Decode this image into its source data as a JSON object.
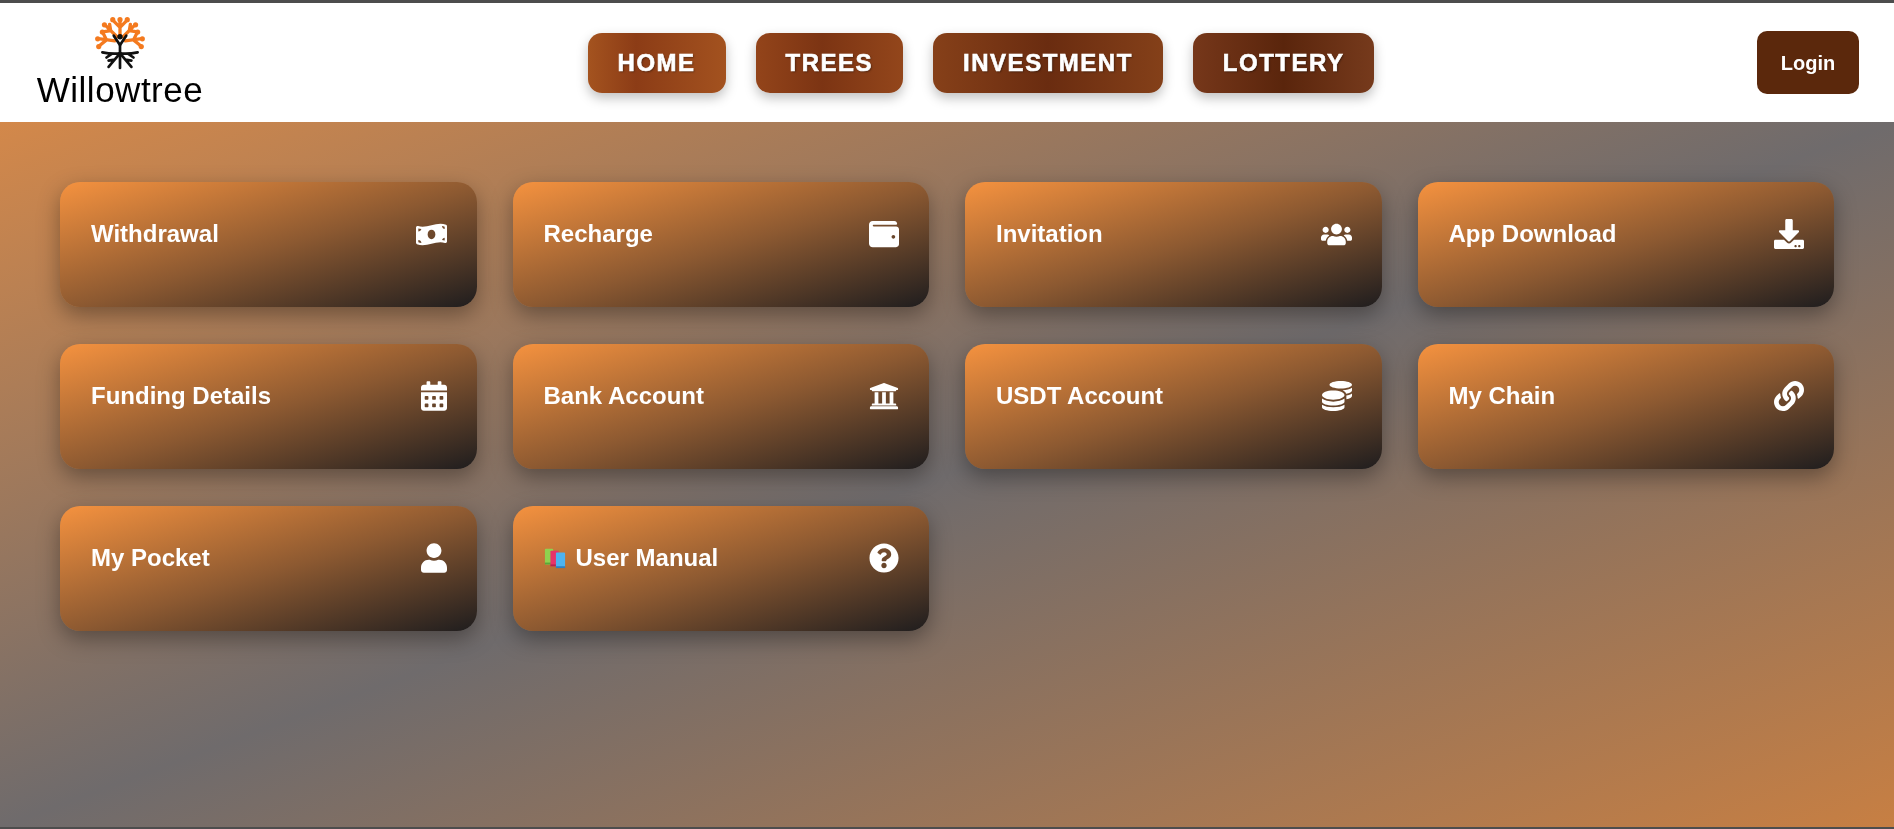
{
  "logo": {
    "name": "Willowtree"
  },
  "nav": [
    {
      "label": "HOME"
    },
    {
      "label": "TREES"
    },
    {
      "label": "INVESTMENT"
    },
    {
      "label": "LOTTERY"
    }
  ],
  "login_button": {
    "label": "Login"
  },
  "cards": [
    {
      "label": "Withdrawal",
      "kind": "plain"
    },
    {
      "label": "Recharge",
      "kind": "plain"
    },
    {
      "label": "Invitation",
      "kind": "plain"
    },
    {
      "label": "App Download",
      "kind": "plain"
    },
    {
      "label": "Funding Details",
      "kind": "plain"
    },
    {
      "label": "Bank Account",
      "kind": "plain"
    },
    {
      "label": "USDT Account",
      "kind": "plain"
    },
    {
      "label": "My Chain",
      "kind": "plain"
    },
    {
      "label": "My Pocket",
      "kind": "plain"
    },
    {
      "label": "User Manual",
      "kind": "illustrated"
    }
  ]
}
